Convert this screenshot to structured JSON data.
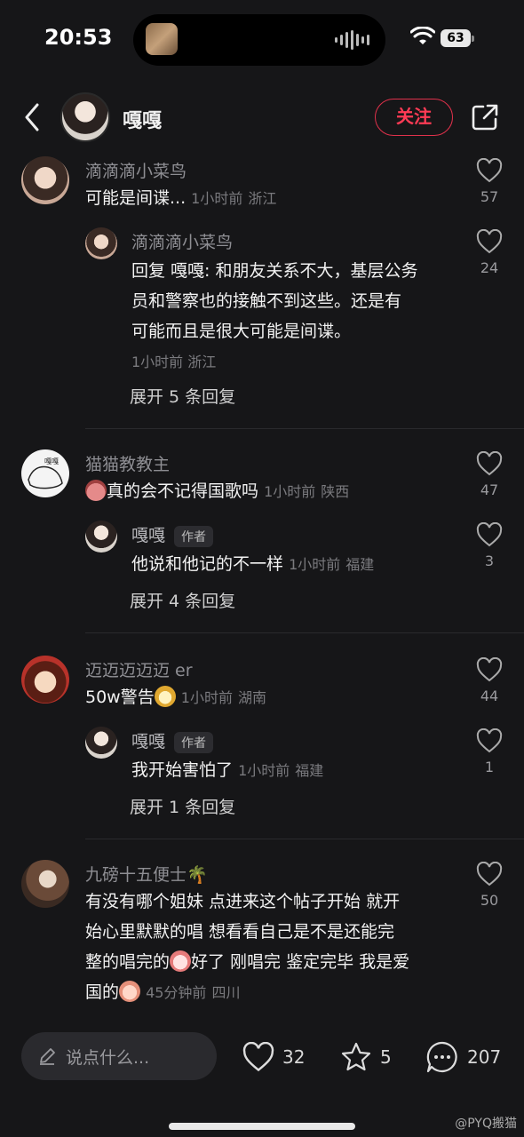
{
  "status": {
    "time": "20:53",
    "battery": "63"
  },
  "header": {
    "name": "嘎嘎",
    "follow_label": "关注"
  },
  "comments": [
    {
      "user": "滴滴滴小菜鸟",
      "text": "可能是间谍...",
      "time": "1小时前",
      "loc": "浙江",
      "likes": "57",
      "reply": {
        "user": "滴滴滴小菜鸟",
        "line1": "回复 嘎嘎: 和朋友关系不大，基层公务",
        "line2": "员和警察也的接触不到这些。还是有",
        "line3": "可能而且是很大可能是间谍。",
        "time": "1小时前",
        "loc": "浙江",
        "likes": "24"
      },
      "expand": "展开 5 条回复"
    },
    {
      "user": "猫猫教教主",
      "text": "真的会不记得国歌吗",
      "time": "1小时前",
      "loc": "陕西",
      "likes": "47",
      "reply": {
        "user": "嘎嘎",
        "badge": "作者",
        "text": "他说和他记的不一样",
        "time": "1小时前",
        "loc": "福建",
        "likes": "3"
      },
      "expand": "展开 4 条回复"
    },
    {
      "user": "迈迈迈迈迈 er",
      "text": "50w警告",
      "time": "1小时前",
      "loc": "湖南",
      "likes": "44",
      "reply": {
        "user": "嘎嘎",
        "badge": "作者",
        "text": "我开始害怕了",
        "time": "1小时前",
        "loc": "福建",
        "likes": "1"
      },
      "expand": "展开 1 条回复"
    },
    {
      "user": "九磅十五便士🌴",
      "line1": "有没有哪个姐妹 点进来这个帖子开始 就开",
      "line2": "始心里默默的唱 想看看自己是不是还能完",
      "line3a": "整的唱完的",
      "line3b": "好了 刚唱完 鉴定完毕 我是爱",
      "line4": "国的",
      "time": "45分钟前",
      "loc": "四川",
      "likes": "50"
    }
  ],
  "bottom": {
    "placeholder": "说点什么...",
    "likes": "32",
    "stars": "5",
    "comments": "207"
  },
  "watermark": "@PYQ搬猫",
  "colors": {
    "background": "#161618",
    "accent": "#ff3b55",
    "muted": "#8e8e93"
  }
}
